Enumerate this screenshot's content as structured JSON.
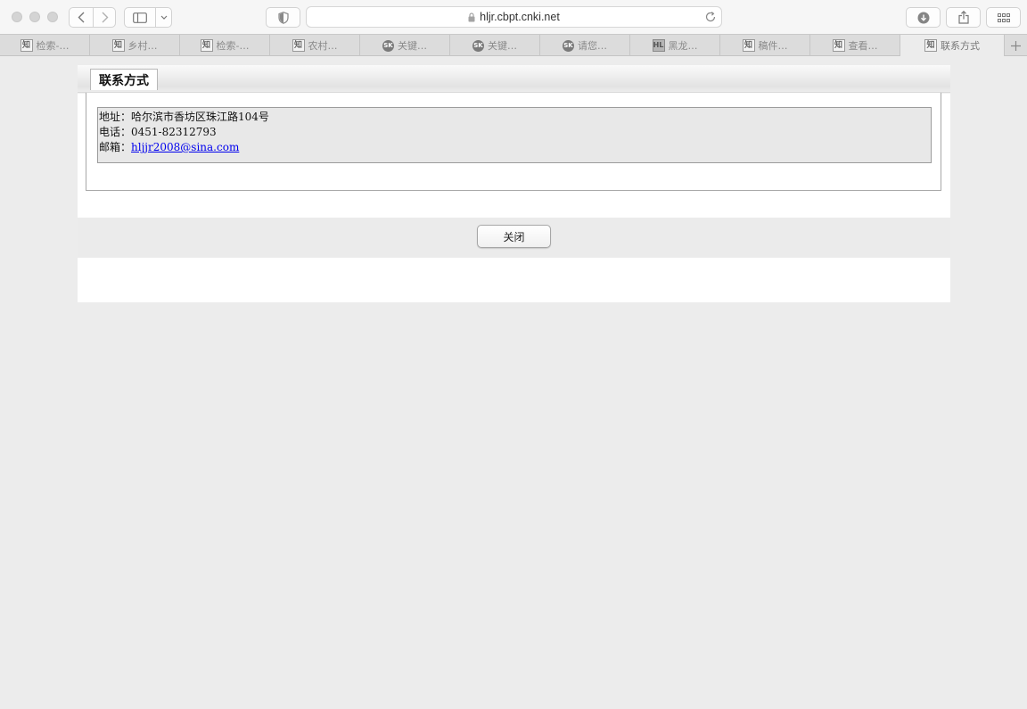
{
  "browser": {
    "url": "hljr.cbpt.cnki.net",
    "tabs": [
      {
        "label": "检索-…",
        "icon": "cnki-zhi-icon",
        "active": false
      },
      {
        "label": "乡村…",
        "icon": "cnki-zhi-icon",
        "active": false
      },
      {
        "label": "检索-…",
        "icon": "cnki-zhi-icon",
        "active": false
      },
      {
        "label": "农村…",
        "icon": "cnki-zhi-icon",
        "active": false
      },
      {
        "label": "关键…",
        "icon": "sk-icon",
        "active": false
      },
      {
        "label": "关键…",
        "icon": "sk-icon",
        "active": false
      },
      {
        "label": "请您…",
        "icon": "sk-icon",
        "active": false
      },
      {
        "label": "黑龙…",
        "icon": "hl-icon",
        "active": false
      },
      {
        "label": "稿件…",
        "icon": "cnki-zhi-icon",
        "active": false
      },
      {
        "label": "查看…",
        "icon": "cnki-zhi-icon",
        "active": false
      },
      {
        "label": "联系方式",
        "icon": "cnki-zhi-icon",
        "active": true
      }
    ]
  },
  "page": {
    "tab_label": "联系方式",
    "address_label": "地址：",
    "address_value": "哈尔滨市香坊区珠江路104号",
    "phone_label": "电话：",
    "phone_value": "0451-82312793",
    "email_label": "邮箱：",
    "email_value": "hljjr2008@sina.com",
    "close_button": "关闭"
  }
}
